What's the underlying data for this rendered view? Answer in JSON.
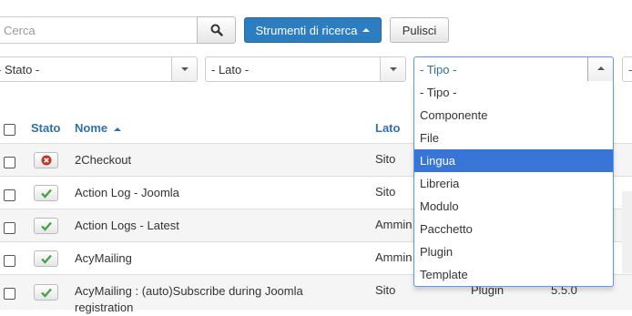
{
  "search": {
    "placeholder": "Cerca"
  },
  "toolbar": {
    "search_tools_label": "Strumenti di ricerca",
    "clear_label": "Pulisci"
  },
  "filters": {
    "status": "- Stato -",
    "side": "- Lato -",
    "type": "- Tipo -",
    "partial": "-"
  },
  "type_options": [
    "- Tipo -",
    "Componente",
    "File",
    "Lingua",
    "Libreria",
    "Modulo",
    "Pacchetto",
    "Plugin",
    "Template"
  ],
  "type_highlighted": "Lingua",
  "table": {
    "headers": {
      "status": "Stato",
      "name": "Nome",
      "side": "Lato"
    },
    "rows": [
      {
        "status": "disabled",
        "name": "2Checkout",
        "side": "Sito",
        "type": "",
        "version": ""
      },
      {
        "status": "enabled",
        "name": "Action Log - Joomla",
        "side": "Sito",
        "type": "",
        "version": ""
      },
      {
        "status": "enabled",
        "name": "Action Logs - Latest",
        "side": "Ammin",
        "type": "",
        "version": ""
      },
      {
        "status": "enabled",
        "name": "AcyMailing",
        "side": "Ammin",
        "type": "",
        "version": ""
      },
      {
        "status": "enabled",
        "name": "AcyMailing : (auto)Subscribe during Joomla registration",
        "side": "Sito",
        "type": "Plugin",
        "version": "5.5.0"
      }
    ]
  },
  "colors": {
    "primary": "#2d7ec0",
    "link": "#3071a9",
    "success": "#46a546",
    "danger": "#bd362f",
    "highlight": "#3875d7"
  }
}
